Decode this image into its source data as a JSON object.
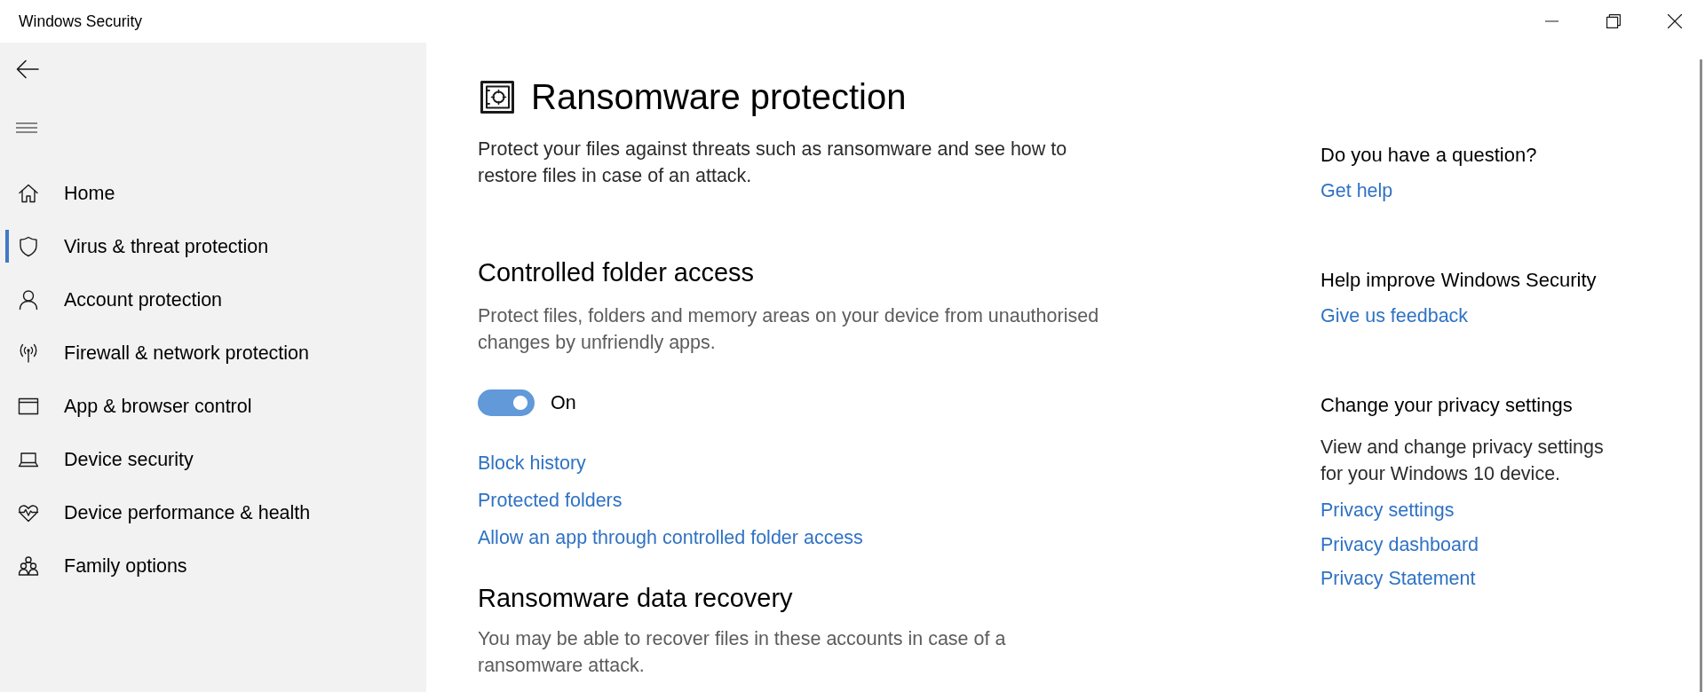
{
  "window": {
    "title": "Windows Security"
  },
  "sidebar": {
    "items": [
      {
        "label": "Home",
        "selected": false
      },
      {
        "label": "Virus & threat protection",
        "selected": true
      },
      {
        "label": "Account protection",
        "selected": false
      },
      {
        "label": "Firewall & network protection",
        "selected": false
      },
      {
        "label": "App & browser control",
        "selected": false
      },
      {
        "label": "Device security",
        "selected": false
      },
      {
        "label": "Device performance & health",
        "selected": false
      },
      {
        "label": "Family options",
        "selected": false
      }
    ]
  },
  "page": {
    "title": "Ransomware protection",
    "description": "Protect your files against threats such as ransomware and see how to restore files in case of an attack."
  },
  "sections": [
    {
      "heading": "Controlled folder access",
      "description": "Protect files, folders and memory areas on your device from unauthorised changes by unfriendly apps.",
      "toggle": {
        "on": true,
        "label": "On"
      },
      "links": [
        "Block history",
        "Protected folders",
        "Allow an app through controlled folder access"
      ]
    },
    {
      "heading": "Ransomware data recovery",
      "description": "You may be able to recover files in these accounts in case of a ransomware attack."
    }
  ],
  "side_panel": [
    {
      "heading": "Do you have a question?",
      "links": [
        "Get help"
      ]
    },
    {
      "heading": "Help improve Windows Security",
      "links": [
        "Give us feedback"
      ]
    },
    {
      "heading": "Change your privacy settings",
      "description": "View and change privacy settings for your Windows 10 device.",
      "links": [
        "Privacy settings",
        "Privacy dashboard",
        "Privacy Statement"
      ]
    }
  ]
}
